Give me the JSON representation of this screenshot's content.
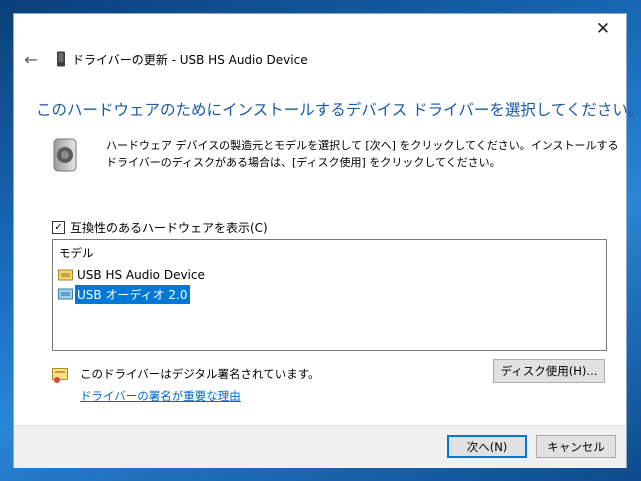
{
  "window": {
    "title": "ドライバーの更新 - USB HS Audio Device",
    "close_glyph": "✕",
    "back_glyph": "←"
  },
  "heading": "このハードウェアのためにインストールするデバイス ドライバーを選択してください。",
  "description": "ハードウェア デバイスの製造元とモデルを選択して [次へ] をクリックしてください。インストールするドライバーのディスクがある場合は、[ディスク使用] をクリックしてください。",
  "compat_checkbox": {
    "label": "互換性のあるハードウェアを表示(C)",
    "checked": true,
    "check_glyph": "✓"
  },
  "model_list": {
    "header": "モデル",
    "items": [
      {
        "label": "USB HS Audio Device",
        "selected": false
      },
      {
        "label": "USB オーディオ 2.0",
        "selected": true
      }
    ]
  },
  "signature": {
    "text": "このドライバーはデジタル署名されています。",
    "link": "ドライバーの署名が重要な理由"
  },
  "buttons": {
    "have_disk": "ディスク使用(H)...",
    "next": "次へ(N)",
    "cancel": "キャンセル"
  },
  "colors": {
    "accent": "#0078d7",
    "heading": "#1a5aa8",
    "link": "#0066cc"
  },
  "icons": {
    "title": "device-icon",
    "speaker": "speaker-icon",
    "driver": "driver-icon",
    "signature": "certificate-icon"
  }
}
